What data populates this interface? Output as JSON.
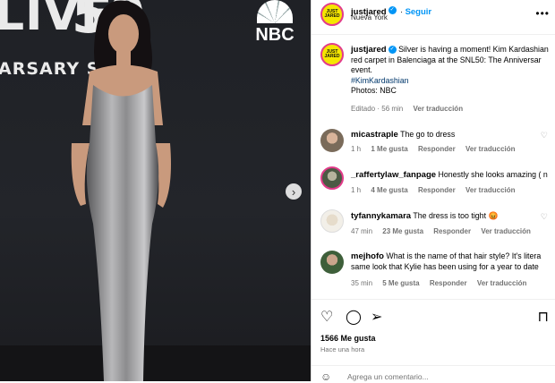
{
  "photo": {
    "backdrop_line1": "LIVE",
    "backdrop_50": "50",
    "backdrop_line2": "ARSARY SPE",
    "network_logo": "NBC",
    "next_icon": "chevron-right-icon"
  },
  "header": {
    "avatar_text": "JUST JARED",
    "username": "justjared",
    "follow_label": "Seguir",
    "location": "Nueva York",
    "more_icon": "more-icon"
  },
  "caption": {
    "username": "justjared",
    "line1": "Silver is having a moment! Kim Kardashian",
    "line2": "red carpet in Balenciaga at the SNL50: The Anniversar",
    "line3": "event.",
    "hashtag": "#KimKardashian",
    "photos": "Photos: NBC",
    "edited": "Editado · 56 min",
    "see_translation": "Ver traducción"
  },
  "comments": [
    {
      "username": "micastraple",
      "text": "The go to dress",
      "time": "1 h",
      "likes": "1 Me gusta",
      "reply": "Responder",
      "translate": "Ver traducción"
    },
    {
      "username": "_raffertylaw_fanpage",
      "text": "Honestly she looks amazing ( n",
      "time": "1 h",
      "likes": "4 Me gusta",
      "reply": "Responder",
      "translate": "Ver traducción"
    },
    {
      "username": "tyfannykamara",
      "text": "The dress is too tight 😡",
      "time": "47 min",
      "likes": "23 Me gusta",
      "reply": "Responder",
      "translate": "Ver traducción"
    },
    {
      "username": "mejhofo",
      "text": "What is the name of that hair style? It's litera",
      "text2": "same look that Kylie has been using for a year to date",
      "time": "35 min",
      "likes": "5 Me gusta",
      "reply": "Responder",
      "translate": "Ver traducción"
    }
  ],
  "footer": {
    "likes": "1566 Me gusta",
    "when": "Hace una hora",
    "comment_placeholder": "Agrega un comentario..."
  },
  "colors": {
    "accent": "#0095f6",
    "avatar_bg": "#f5e600",
    "avatar_ring": "#e23b8a"
  }
}
